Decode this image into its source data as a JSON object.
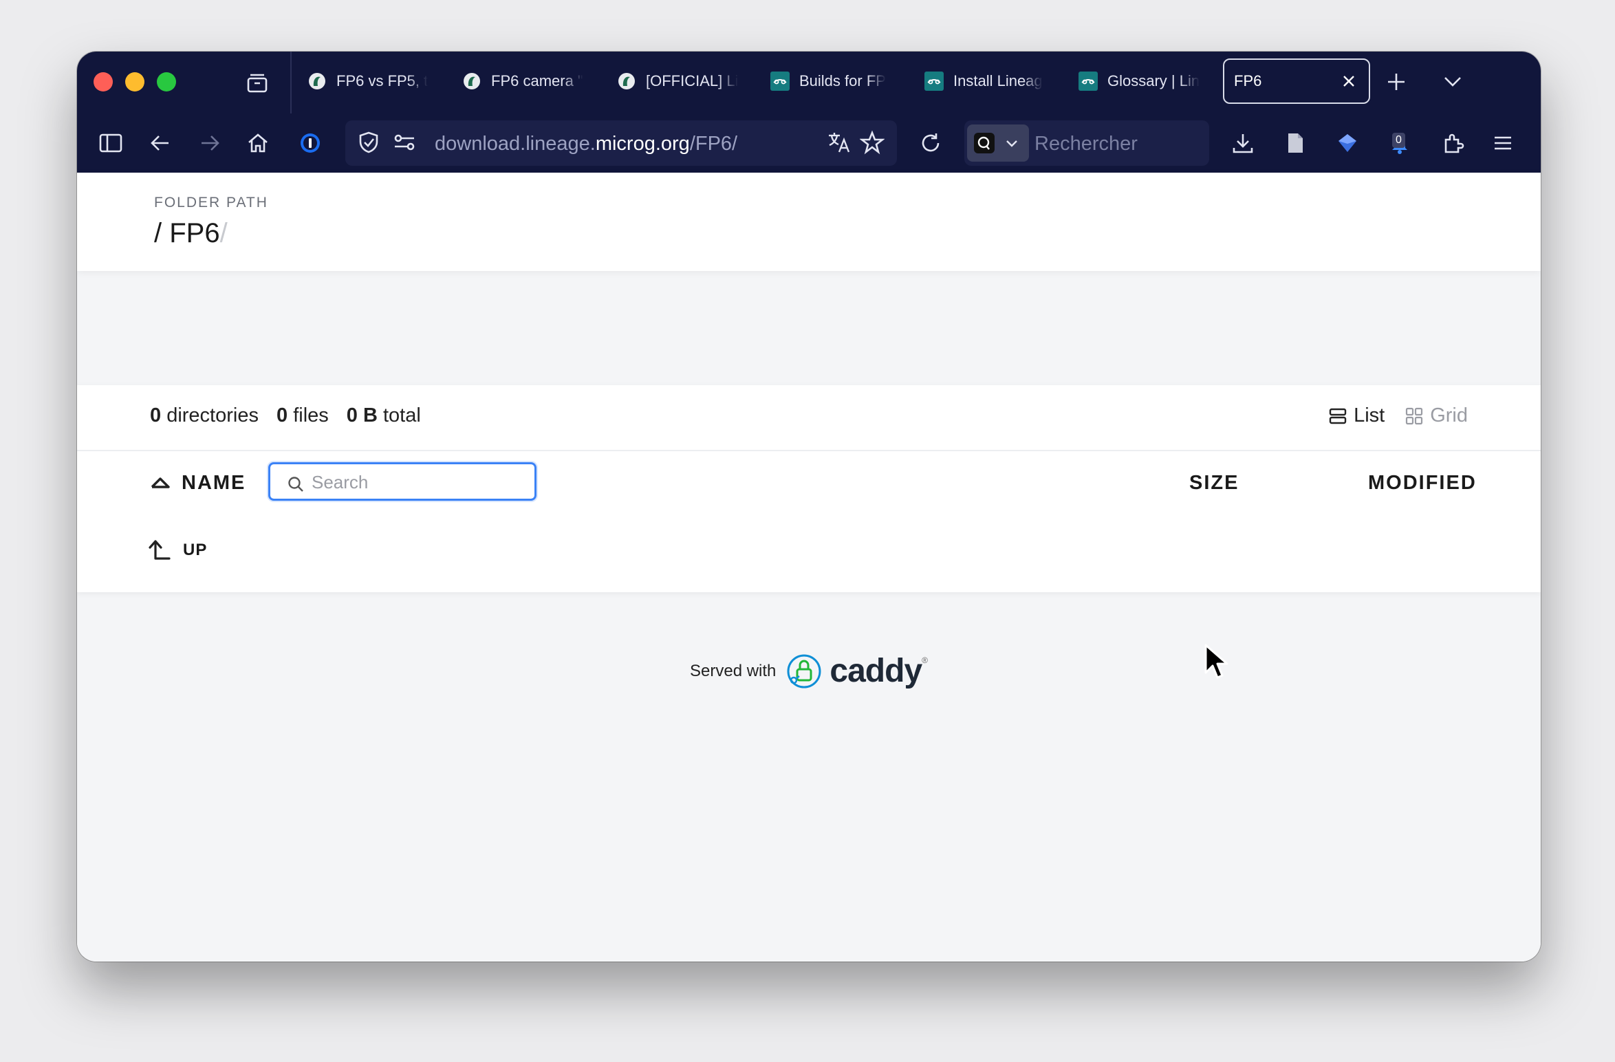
{
  "browser": {
    "tabs": [
      {
        "title": "FP6 vs FP5, t",
        "favicon": "fairphone-forum-icon"
      },
      {
        "title": "FP6 camera \"",
        "favicon": "fairphone-forum-icon"
      },
      {
        "title": "[OFFICIAL] Li",
        "favicon": "fairphone-forum-icon"
      },
      {
        "title": "Builds for FP",
        "favicon": "lineageos-icon"
      },
      {
        "title": "Install Lineag",
        "favicon": "lineageos-icon"
      },
      {
        "title": "Glossary | Lin",
        "favicon": "lineageos-icon"
      }
    ],
    "active_tab": {
      "title": "FP6"
    },
    "url": {
      "prefix": "download.lineage.",
      "host": "microg.org",
      "path": "/FP6/"
    },
    "search_placeholder": "Rechercher",
    "notification_count": "0",
    "colors": {
      "chrome": "#11163b",
      "urlbar": "#1b2048"
    }
  },
  "page": {
    "folder_label": "FOLDER PATH",
    "breadcrumb": {
      "sep": "/",
      "folder": "FP6",
      "trail": "/"
    },
    "summary": {
      "directories_count": "0",
      "directories_label": "directories",
      "files_count": "0",
      "files_label": "files",
      "total_size": "0 B",
      "total_label": "total"
    },
    "view": {
      "list_label": "List",
      "grid_label": "Grid",
      "selected": "List"
    },
    "columns": {
      "name": "NAME",
      "size": "SIZE",
      "modified": "MODIFIED"
    },
    "search": {
      "placeholder": "Search",
      "value": ""
    },
    "up_label": "UP",
    "footer": {
      "served_with": "Served with",
      "brand": "caddy"
    },
    "colors": {
      "focus": "#3b82f6",
      "caddy_green": "#22b638",
      "caddy_blue": "#0f8fd6"
    }
  }
}
